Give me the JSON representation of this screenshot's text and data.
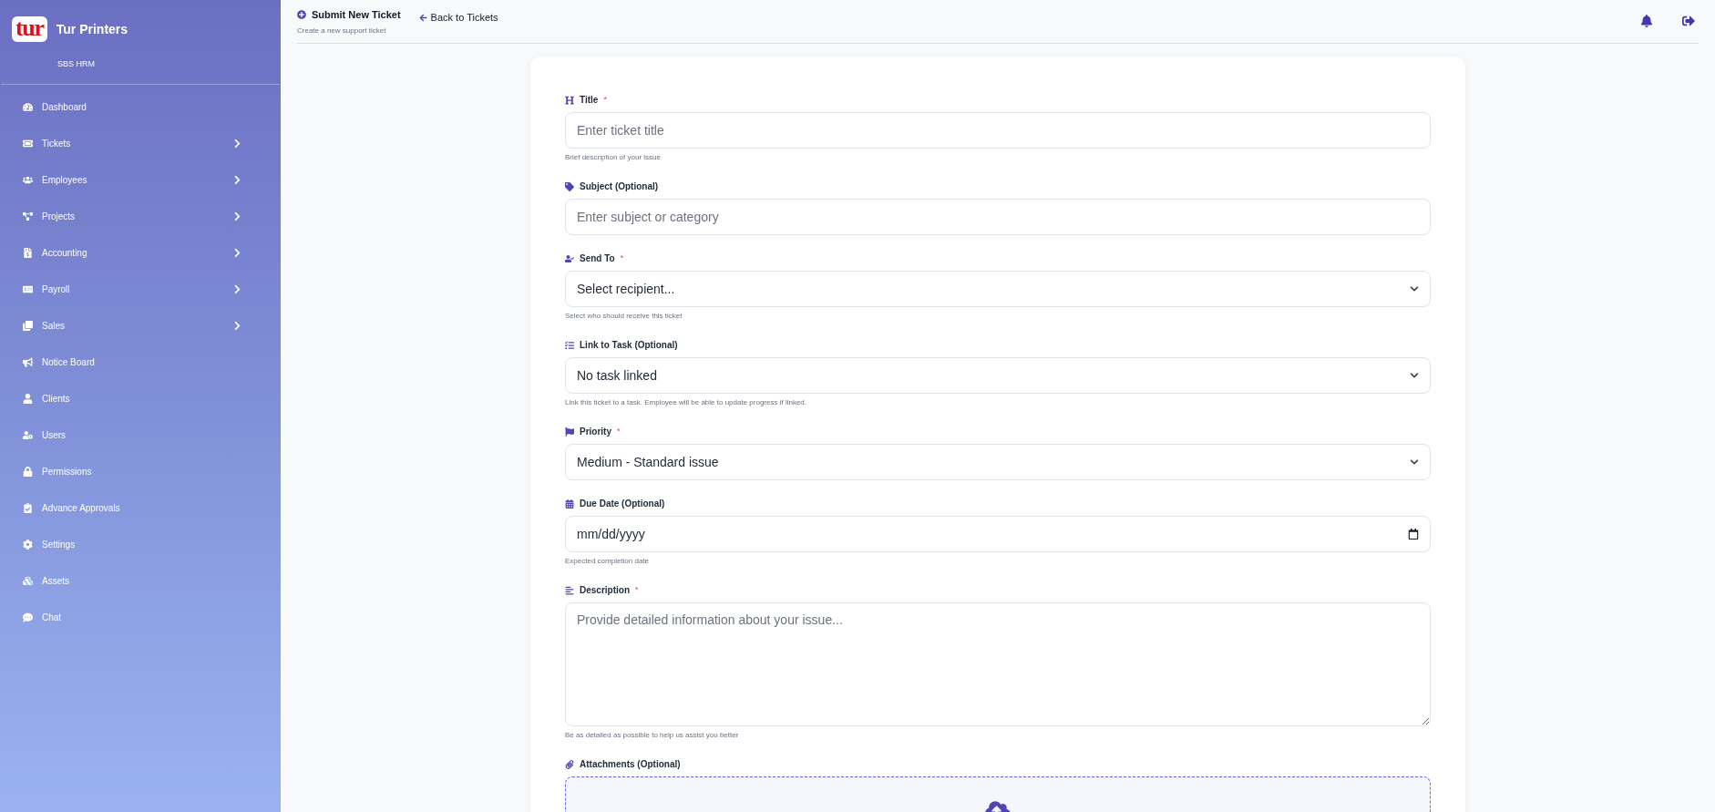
{
  "sidebar": {
    "logo": "tur",
    "brand": "Tur Printers",
    "subtitle": "SBS HRM",
    "items": [
      {
        "label": "Dashboard",
        "expandable": false
      },
      {
        "label": "Tickets",
        "expandable": true
      },
      {
        "label": "Employees",
        "expandable": true
      },
      {
        "label": "Projects",
        "expandable": true
      },
      {
        "label": "Accounting",
        "expandable": true
      },
      {
        "label": "Payroll",
        "expandable": true
      },
      {
        "label": "Sales",
        "expandable": true
      },
      {
        "label": "Notice Board",
        "expandable": false
      },
      {
        "label": "Clients",
        "expandable": false
      },
      {
        "label": "Users",
        "expandable": false
      },
      {
        "label": "Permissions",
        "expandable": false
      },
      {
        "label": "Advance Approvals",
        "expandable": false
      },
      {
        "label": "Settings",
        "expandable": false
      },
      {
        "label": "Assets",
        "expandable": false
      },
      {
        "label": "Chat",
        "expandable": false
      }
    ]
  },
  "header": {
    "title": "Submit New Ticket",
    "subtitle": "Create a new support ticket",
    "back_link": "Back to Tickets"
  },
  "form": {
    "fields": [
      {
        "kind": "input",
        "label": "Title",
        "required_mark": "*",
        "placeholder": "Enter ticket title",
        "hint": "Brief description of your issue"
      },
      {
        "kind": "input",
        "label": "Subject (Optional)",
        "placeholder": "Enter subject or category"
      },
      {
        "kind": "select",
        "label": "Send To",
        "required_mark": "*",
        "value": "Select recipient...",
        "hint": "Select who should receive this ticket"
      },
      {
        "kind": "select",
        "label": "Link to Task (Optional)",
        "value": "No task linked",
        "hint": "Link this ticket to a task. Employee will be able to update progress if linked."
      },
      {
        "kind": "select",
        "label": "Priority",
        "required_mark": "*",
        "value": "Medium - Standard issue"
      },
      {
        "kind": "date",
        "label": "Due Date (Optional)",
        "value": "mm/dd/yyyy",
        "hint": "Expected completion date"
      },
      {
        "kind": "textarea",
        "label": "Description",
        "required_mark": "*",
        "placeholder": "Provide detailed information about your issue...",
        "hint": "Be as detailed as possible to help us assist you better"
      },
      {
        "kind": "upload",
        "label": "Attachments (Optional)"
      }
    ]
  }
}
